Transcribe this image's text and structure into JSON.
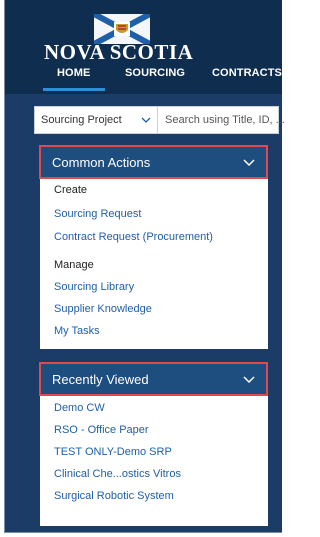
{
  "header": {
    "logo_text": "NOVA SCOTIA",
    "nav": [
      {
        "label": "HOME",
        "active": true
      },
      {
        "label": "SOURCING",
        "active": false
      },
      {
        "label": "CONTRACTS",
        "active": false
      }
    ]
  },
  "search": {
    "select_value": "Sourcing Project",
    "placeholder": "Search using Title, ID, ..."
  },
  "common_actions": {
    "title": "Common Actions",
    "create_label": "Create",
    "create_items": [
      "Sourcing Request",
      "Contract Request (Procurement)"
    ],
    "manage_label": "Manage",
    "manage_items": [
      "Sourcing Library",
      "Supplier Knowledge",
      "My Tasks"
    ]
  },
  "recently_viewed": {
    "title": "Recently Viewed",
    "items": [
      "Demo CW",
      "RSO - Office Paper",
      "TEST ONLY-Demo SRP",
      "Clinical Che...ostics Vitros",
      "Surgical Robotic System"
    ]
  },
  "colors": {
    "header_bg": "#0f2d4f",
    "page_bg": "#1a3c66",
    "panel_header": "#1e4d80",
    "highlight_border": "#e04a4f",
    "link": "#1f5fa8",
    "nav_active_underline": "#2d8fd6"
  }
}
